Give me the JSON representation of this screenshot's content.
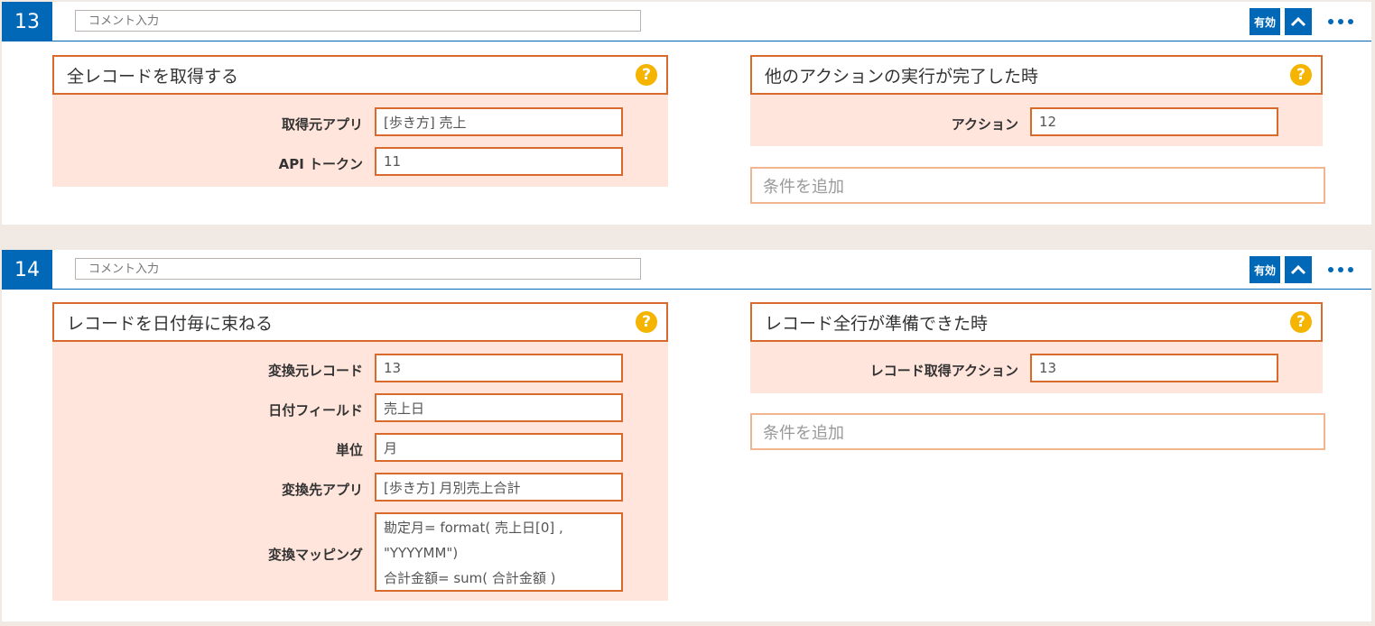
{
  "colors": {
    "primary": "#0068b7",
    "accent": "#d86a2b",
    "panel": "#ffe5dc",
    "help": "#f5b400"
  },
  "steps": [
    {
      "number": "13",
      "comment_placeholder": "コメント入力",
      "enabled_label": "有効",
      "action": {
        "title": "全レコードを取得する",
        "help": "?",
        "fields": [
          {
            "label": "取得元アプリ",
            "value": "[歩き方] 売上"
          },
          {
            "label": "API トークン",
            "value": "11"
          }
        ]
      },
      "trigger": {
        "title": "他のアクションの実行が完了した時",
        "help": "?",
        "fields": [
          {
            "label": "アクション",
            "value": "12"
          }
        ],
        "add_condition_placeholder": "条件を追加"
      }
    },
    {
      "number": "14",
      "comment_placeholder": "コメント入力",
      "enabled_label": "有効",
      "action": {
        "title": "レコードを日付毎に束ねる",
        "help": "?",
        "fields": [
          {
            "label": "変換元レコード",
            "value": "13"
          },
          {
            "label": "日付フィールド",
            "value": "売上日"
          },
          {
            "label": "単位",
            "value": "月"
          },
          {
            "label": "変換先アプリ",
            "value": "[歩き方] 月別売上合計"
          },
          {
            "label": "変換マッピング",
            "value": "勘定月= format( 売上日[0] , \"YYYYMM\")\n合計金額= sum( 合計金額 )"
          }
        ]
      },
      "trigger": {
        "title": "レコード全行が準備できた時",
        "help": "?",
        "fields": [
          {
            "label": "レコード取得アクション",
            "value": "13"
          }
        ],
        "add_condition_placeholder": "条件を追加"
      }
    }
  ]
}
